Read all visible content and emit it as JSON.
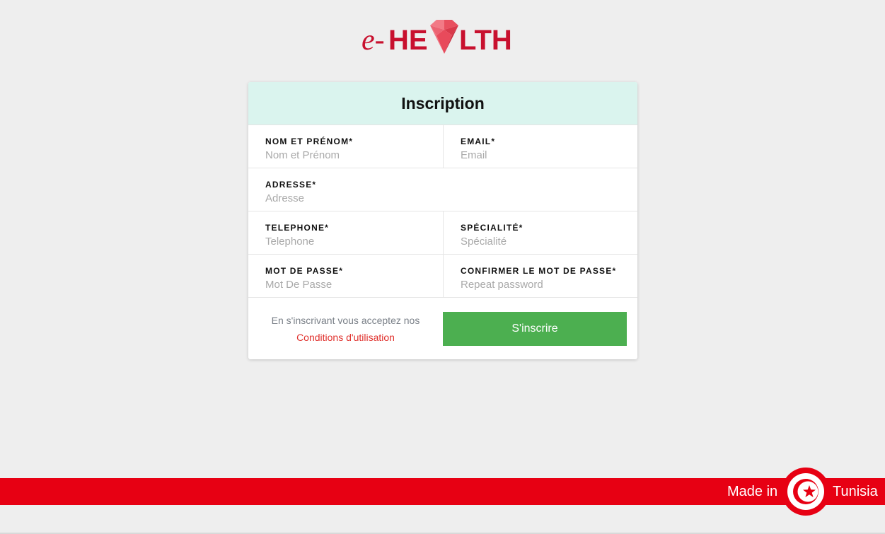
{
  "logo": {
    "prefix": "e-",
    "letters_left": "HE",
    "letters_right": "LTH",
    "alt": "e-HEALTH",
    "brand_color": "#c8102e"
  },
  "form": {
    "title": "Inscription",
    "fields": {
      "nom": {
        "label": "NOM ET PRÉNOM*",
        "placeholder": "Nom et Prénom"
      },
      "email": {
        "label": "EMAIL*",
        "placeholder": "Email"
      },
      "adresse": {
        "label": "ADRESSE*",
        "placeholder": "Adresse"
      },
      "telephone": {
        "label": "TELEPHONE*",
        "placeholder": "Telephone"
      },
      "specialite": {
        "label": "SPÉCIALITÉ*",
        "placeholder": "Spécialité"
      },
      "password": {
        "label": "MOT DE PASSE*",
        "placeholder": "Mot De Passe"
      },
      "confirm": {
        "label": "CONFIRMER LE MOT DE PASSE*",
        "placeholder": "Repeat password"
      }
    },
    "terms_text": "En s'inscrivant vous acceptez nos",
    "terms_link": "Conditions d'utilisation",
    "submit_label": "S'inscrire",
    "header_color": "#daf4ee",
    "submit_color": "#4caf50"
  },
  "footer": {
    "made_in": "Made in",
    "country": "Tunisia",
    "band_color": "#e70013",
    "flag_icon": "tunisia-flag-icon"
  }
}
